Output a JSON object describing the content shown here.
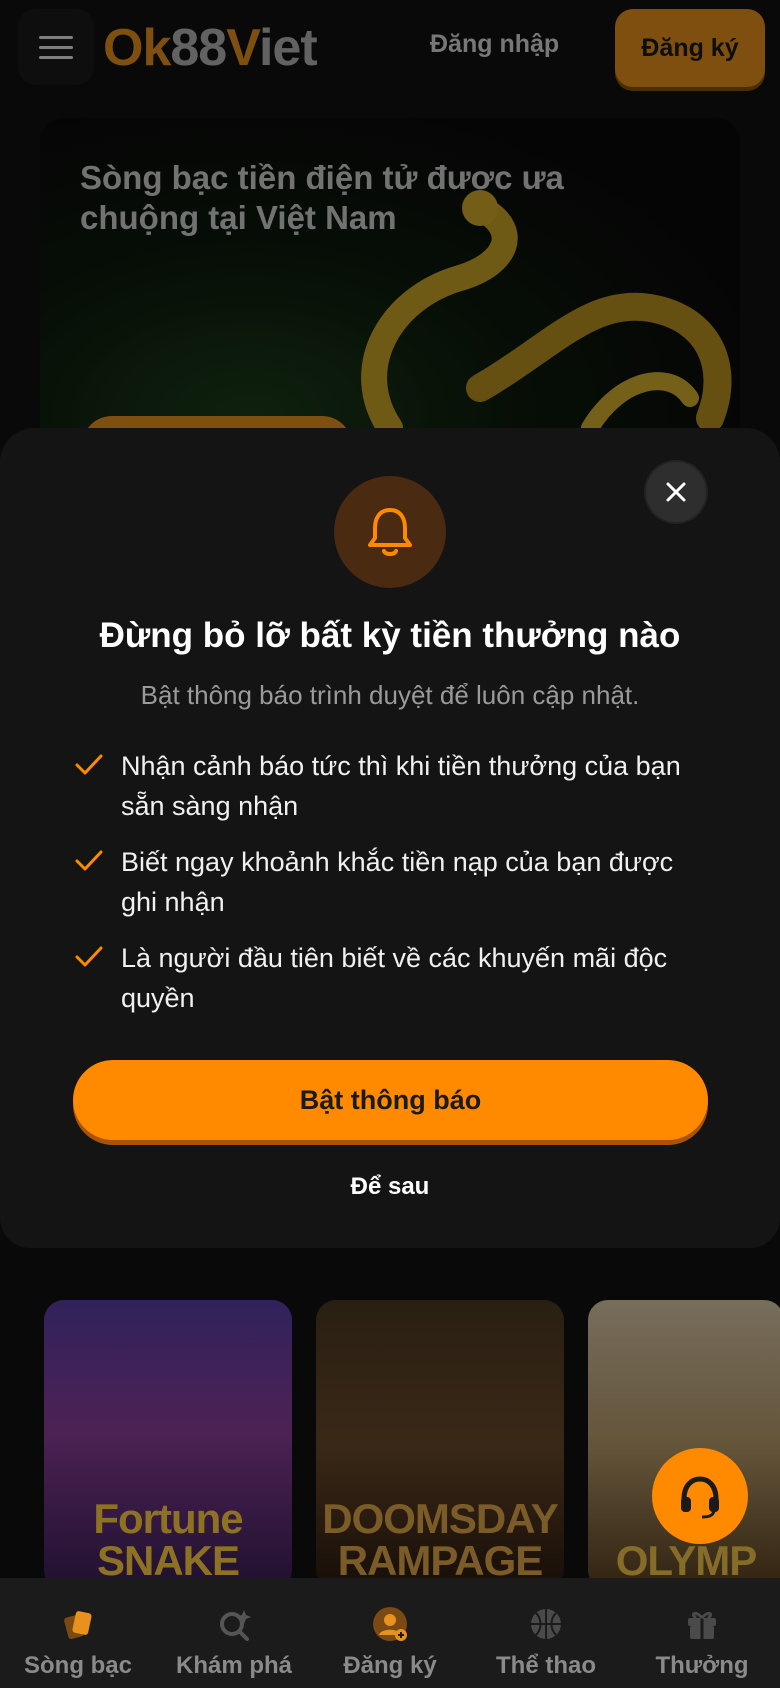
{
  "header": {
    "logo_parts": [
      "Ok",
      "88",
      "V",
      "iet"
    ],
    "login_label": "Đăng nhập",
    "signup_label": "Đăng ký"
  },
  "hero": {
    "title": "Sòng bạc tiền điện tử được ưa chuộng tại Việt Nam"
  },
  "modal": {
    "title": "Đừng bỏ lỡ bất kỳ tiền thưởng nào",
    "subtitle": "Bật thông báo trình duyệt để luôn cập nhật.",
    "benefits": [
      "Nhận cảnh báo tức thì khi tiền thưởng của bạn sẵn sàng nhận",
      "Biết ngay khoảnh khắc tiền nạp của bạn được ghi nhận",
      "Là người đầu tiên biết về các khuyến mãi độc quyền"
    ],
    "enable_label": "Bật thông báo",
    "later_label": "Để sau"
  },
  "games": [
    {
      "title": "Fortune SNAKE"
    },
    {
      "title": "DOOMSDAY RAMPAGE"
    },
    {
      "title": "OLYMP"
    }
  ],
  "bottom_nav": [
    {
      "label": "Sòng bạc",
      "icon": "cards-icon"
    },
    {
      "label": "Khám phá",
      "icon": "explore-icon"
    },
    {
      "label": "Đăng ký",
      "icon": "user-add-icon"
    },
    {
      "label": "Thể thao",
      "icon": "basketball-icon"
    },
    {
      "label": "Thưởng",
      "icon": "gift-icon"
    }
  ],
  "colors": {
    "accent": "#ff8a00",
    "logo_orange": "#e8911c",
    "background": "#121212",
    "modal_bg": "#141414"
  }
}
